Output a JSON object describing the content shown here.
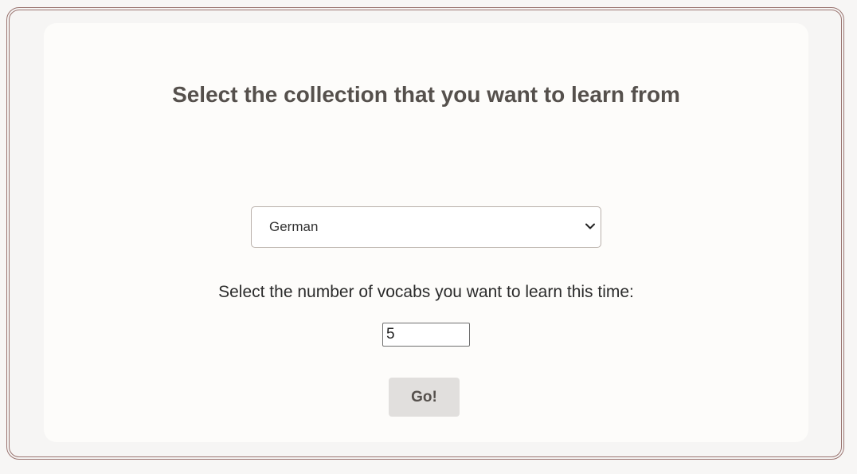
{
  "page": {
    "title": "Select the collection that you want to learn from"
  },
  "collection_select": {
    "selected": "German",
    "icon": "chevron-down-icon"
  },
  "vocab_count": {
    "label": "Select the number of vocabs you want to learn this time:",
    "value": "5"
  },
  "actions": {
    "go_label": "Go!"
  },
  "colors": {
    "frame_border": "#9a7470",
    "card_background": "#fdfcfa",
    "title_text": "#55504c",
    "button_background": "#e1dfdd"
  }
}
